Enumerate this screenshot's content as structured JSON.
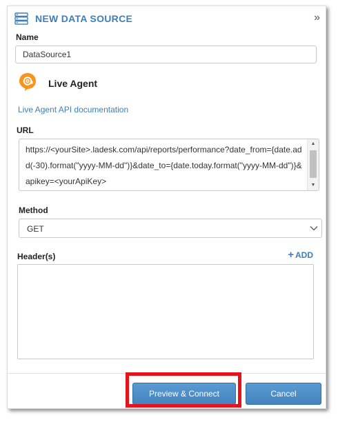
{
  "header": {
    "title": "NEW DATA SOURCE",
    "collapse_glyph": "»",
    "icon": "database-icon"
  },
  "name_field": {
    "label": "Name",
    "value": "DataSource1"
  },
  "connector": {
    "name": "Live Agent",
    "logo_icon": "live-agent-logo",
    "doc_link": "Live Agent API documentation"
  },
  "url_field": {
    "label": "URL",
    "value": "https://<yourSite>.ladesk.com/api/reports/performance?date_from={date.add(-30).format(\"yyyy-MM-dd\")}&date_to={date.today.format(\"yyyy-MM-dd\")}&apikey=<yourApiKey>"
  },
  "method_field": {
    "label": "Method",
    "value": "GET"
  },
  "headers_field": {
    "label": "Header(s)",
    "add_plus": "+",
    "add_label": "ADD",
    "value": ""
  },
  "footer": {
    "preview_label": "Preview & Connect",
    "cancel_label": "Cancel"
  },
  "colors": {
    "accent": "#3d7fb8",
    "button": "#4a8bc7",
    "logo_orange": "#f7941d",
    "highlight": "#e3141c"
  }
}
